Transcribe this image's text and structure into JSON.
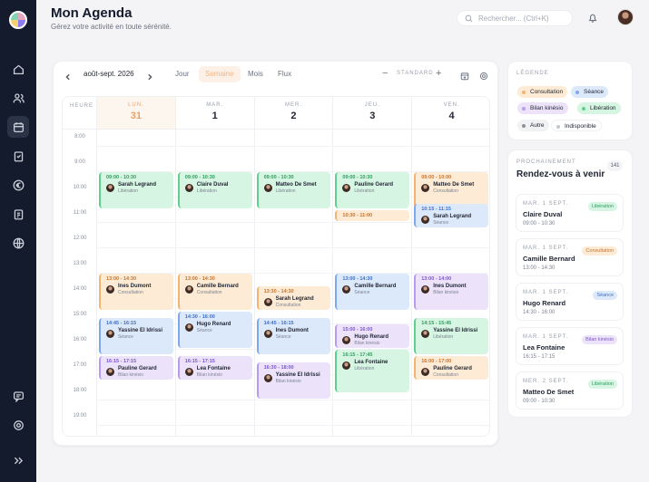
{
  "header": {
    "title": "Mon Agenda",
    "subtitle": "Gérez votre activité en toute sérénité.",
    "search_placeholder": "Rechercher... (Ctrl+K)"
  },
  "sidebar": {
    "items": [
      "home-icon",
      "users-icon",
      "calendar-icon",
      "clipboard-icon",
      "euro-icon",
      "document-icon",
      "globe-icon"
    ],
    "bottom": [
      "chat-icon",
      "settings-icon",
      "collapse-icon"
    ]
  },
  "toolbar": {
    "range": "août-sept. 2026",
    "views": [
      "Jour",
      "Semaine",
      "Mois",
      "Flux"
    ],
    "active_view": "Semaine",
    "zoom_label": "STANDARD",
    "minus": "−",
    "plus": "+"
  },
  "calendar": {
    "heure_label": "HEURE",
    "hours": [
      "8:00",
      "9:00",
      "10:00",
      "11:00",
      "12:00",
      "13:00",
      "14:00",
      "15:00",
      "16:00",
      "17:00",
      "18:00",
      "19:00"
    ],
    "days": [
      {
        "name": "LUN.",
        "num": "31",
        "today": true
      },
      {
        "name": "MAR.",
        "num": "1"
      },
      {
        "name": "MER.",
        "num": "2"
      },
      {
        "name": "JEU.",
        "num": "3"
      },
      {
        "name": "VEN.",
        "num": "4"
      }
    ],
    "events": [
      {
        "day": 0,
        "start": 9,
        "end": 10.5,
        "time": "09:00 - 10:30",
        "name": "Sarah Legrand",
        "type": "Libération",
        "kind": "lib"
      },
      {
        "day": 0,
        "start": 13,
        "end": 14.5,
        "time": "13:00 - 14:30",
        "name": "Ines Dumont",
        "type": "Consultation",
        "kind": "con"
      },
      {
        "day": 0,
        "start": 14.75,
        "end": 16.25,
        "time": "14:45 - 16:15",
        "name": "Yassine El Idrissi",
        "type": "Séance",
        "kind": "sea"
      },
      {
        "day": 0,
        "start": 16.25,
        "end": 17.25,
        "time": "16:15 - 17:15",
        "name": "Pauline Gerard",
        "type": "Bilan kinésio",
        "kind": "bil"
      },
      {
        "day": 1,
        "start": 9,
        "end": 10.5,
        "time": "09:00 - 10:30",
        "name": "Claire Duval",
        "type": "Libération",
        "kind": "lib"
      },
      {
        "day": 1,
        "start": 13,
        "end": 14.5,
        "time": "13:00 - 14:30",
        "name": "Camille Bernard",
        "type": "Consultation",
        "kind": "con"
      },
      {
        "day": 1,
        "start": 14.5,
        "end": 16,
        "time": "14:30 - 16:00",
        "name": "Hugo Renard",
        "type": "Séance",
        "kind": "sea"
      },
      {
        "day": 1,
        "start": 16.25,
        "end": 17.25,
        "time": "16:15 - 17:15",
        "name": "Lea Fontaine",
        "type": "Bilan kinésio",
        "kind": "bil"
      },
      {
        "day": 2,
        "start": 9,
        "end": 10.5,
        "time": "09:00 - 10:30",
        "name": "Matteo De Smet",
        "type": "Libération",
        "kind": "lib"
      },
      {
        "day": 2,
        "start": 13.5,
        "end": 14.5,
        "time": "13:30 - 14:30",
        "name": "Sarah Legrand",
        "type": "Consultation",
        "kind": "con"
      },
      {
        "day": 2,
        "start": 14.75,
        "end": 16.25,
        "time": "14:45 - 16:15",
        "name": "Ines Dumont",
        "type": "Séance",
        "kind": "sea"
      },
      {
        "day": 2,
        "start": 16.5,
        "end": 18,
        "time": "16:30 - 18:00",
        "name": "Yassine El Idrissi",
        "type": "Bilan kinésio",
        "kind": "bil"
      },
      {
        "day": 3,
        "start": 9,
        "end": 10.5,
        "time": "09:00 - 10:30",
        "name": "Pauline Gerard",
        "type": "Libération",
        "kind": "lib"
      },
      {
        "day": 3,
        "start": 10.5,
        "end": 11,
        "time": "10:30 - 11:00",
        "name": "",
        "type": "",
        "kind": "con"
      },
      {
        "day": 3,
        "start": 13,
        "end": 14.5,
        "time": "13:00 - 14:30",
        "name": "Camille Bernard",
        "type": "Séance",
        "kind": "sea"
      },
      {
        "day": 3,
        "start": 15,
        "end": 16,
        "time": "15:00 - 16:00",
        "name": "Hugo Renard",
        "type": "Bilan kinésio",
        "kind": "bil"
      },
      {
        "day": 3,
        "start": 16,
        "end": 17.75,
        "time": "16:15 - 17:45",
        "name": "Lea Fontaine",
        "type": "Libération",
        "kind": "lib"
      },
      {
        "day": 4,
        "start": 9,
        "end": 10.5,
        "time": "09:00 - 10:00",
        "name": "Matteo De Smet",
        "type": "Consultation",
        "kind": "con"
      },
      {
        "day": 4,
        "start": 10.25,
        "end": 11.25,
        "time": "10:15 - 11:15",
        "name": "Sarah Legrand",
        "type": "Séance",
        "kind": "sea"
      },
      {
        "day": 4,
        "start": 13,
        "end": 14.5,
        "time": "13:00 - 14:00",
        "name": "Ines Dumont",
        "type": "Bilan kinésio",
        "kind": "bil"
      },
      {
        "day": 4,
        "start": 14.75,
        "end": 16.25,
        "time": "14:15 - 15:45",
        "name": "Yassine El Idrissi",
        "type": "Libération",
        "kind": "lib"
      },
      {
        "day": 4,
        "start": 16.25,
        "end": 17.25,
        "time": "16:00 - 17:00",
        "name": "Pauline Gerard",
        "type": "Consultation",
        "kind": "con"
      }
    ]
  },
  "colors": {
    "con": {
      "bg": "#fdebd6",
      "border": "#f3b46f",
      "text": "#c5732c"
    },
    "sea": {
      "bg": "#dce9fb",
      "border": "#7fa8ec",
      "text": "#3c6fc6"
    },
    "bil": {
      "bg": "#ece3fb",
      "border": "#b79bee",
      "text": "#7b55c8"
    },
    "lib": {
      "bg": "#d6f5e3",
      "border": "#5fcf8e",
      "text": "#2f9d5c"
    },
    "autre": {
      "bg": "#f1f2f4",
      "border": "#8b909b",
      "text": "#555b66"
    },
    "indispo": {
      "bg": "#ffffff",
      "border": "#c3c7cf",
      "text": "#555b66"
    }
  },
  "legend": {
    "title": "LÉGENDE",
    "items": [
      {
        "label": "Consultation",
        "kind": "con"
      },
      {
        "label": "Séance",
        "kind": "sea"
      },
      {
        "label": "Bilan kinésio",
        "kind": "bil"
      },
      {
        "label": "Libération",
        "kind": "lib"
      },
      {
        "label": "Autre",
        "kind": "autre"
      },
      {
        "label": "Indisponible",
        "kind": "indispo"
      }
    ]
  },
  "upcoming": {
    "label": "PROCHAINEMENT",
    "title": "Rendez-vous à venir",
    "count": "141",
    "items": [
      {
        "date": "MAR. 1 SEPT.",
        "name": "Claire Duval",
        "time": "09:00 - 10:30",
        "tag": "Libération",
        "kind": "lib"
      },
      {
        "date": "MAR. 1 SEPT.",
        "name": "Camille Bernard",
        "time": "13:00 - 14:30",
        "tag": "Consultation",
        "kind": "con"
      },
      {
        "date": "MAR. 1 SEPT.",
        "name": "Hugo Renard",
        "time": "14:30 - 16:00",
        "tag": "Séance",
        "kind": "sea"
      },
      {
        "date": "MAR. 1 SEPT.",
        "name": "Lea Fontaine",
        "time": "16:15 - 17:15",
        "tag": "Bilan kinésio",
        "kind": "bil"
      },
      {
        "date": "MER. 2 SEPT.",
        "name": "Matteo De Smet",
        "time": "09:00 - 10:30",
        "tag": "Libération",
        "kind": "lib"
      }
    ]
  }
}
